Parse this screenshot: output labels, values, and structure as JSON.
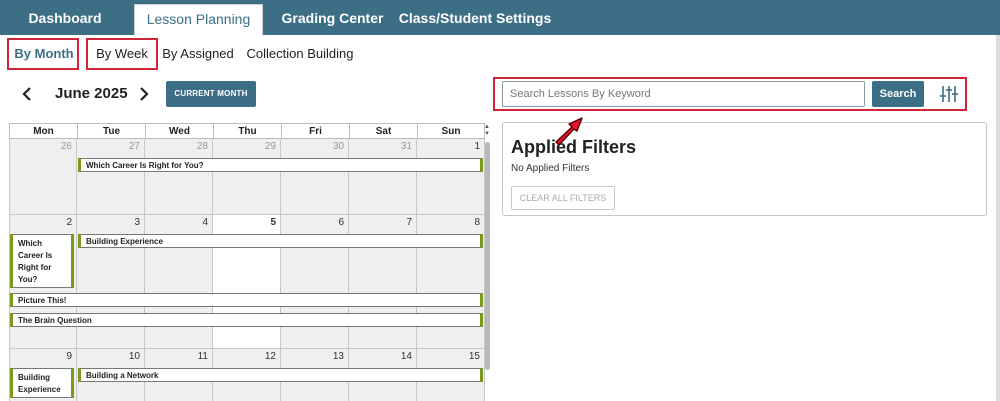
{
  "topnav": {
    "tabs": [
      {
        "label": "Dashboard"
      },
      {
        "label": "Lesson Planning"
      },
      {
        "label": "Grading Center"
      },
      {
        "label": "Class/Student Settings"
      }
    ]
  },
  "subtabs": [
    {
      "label": "By Month"
    },
    {
      "label": "By Week"
    },
    {
      "label": "By Assigned"
    },
    {
      "label": "Collection Building"
    }
  ],
  "month_nav": {
    "label": "June 2025",
    "prev_icon": "chevron-left-icon",
    "next_icon": "chevron-right-icon",
    "current_month_label": "CURRENT MONTH"
  },
  "search": {
    "placeholder": "Search Lessons By Keyword",
    "value": "",
    "button_label": "Search",
    "filter_icon": "sliders-icon"
  },
  "calendar": {
    "weekdays": [
      "Mon",
      "Tue",
      "Wed",
      "Thu",
      "Fri",
      "Sat",
      "Sun"
    ],
    "weeks": [
      {
        "days": [
          "26",
          "27",
          "28",
          "29",
          "30",
          "31",
          "1"
        ]
      },
      {
        "days": [
          "2",
          "3",
          "4",
          "5",
          "6",
          "7",
          "8"
        ]
      },
      {
        "days": [
          "9",
          "10",
          "11",
          "12",
          "13",
          "14",
          "15"
        ]
      }
    ],
    "today": "5",
    "events": {
      "w1_e1": "Which Career Is Right for You?",
      "w2_e1": "Which Career Is Right for You?",
      "w2_e2": "Building Experience",
      "w2_e3": "Picture This!",
      "w2_e4": "The Brain Question",
      "w3_e1": "Building Experience",
      "w3_e2": "Building a Network"
    },
    "event_color": "#7a9a1a"
  },
  "filters": {
    "title": "Applied Filters",
    "empty_text": "No Applied Filters",
    "clear_label": "CLEAR ALL FILTERS"
  },
  "colors": {
    "accent": "#3c6e86",
    "highlight": "#d0243a"
  }
}
